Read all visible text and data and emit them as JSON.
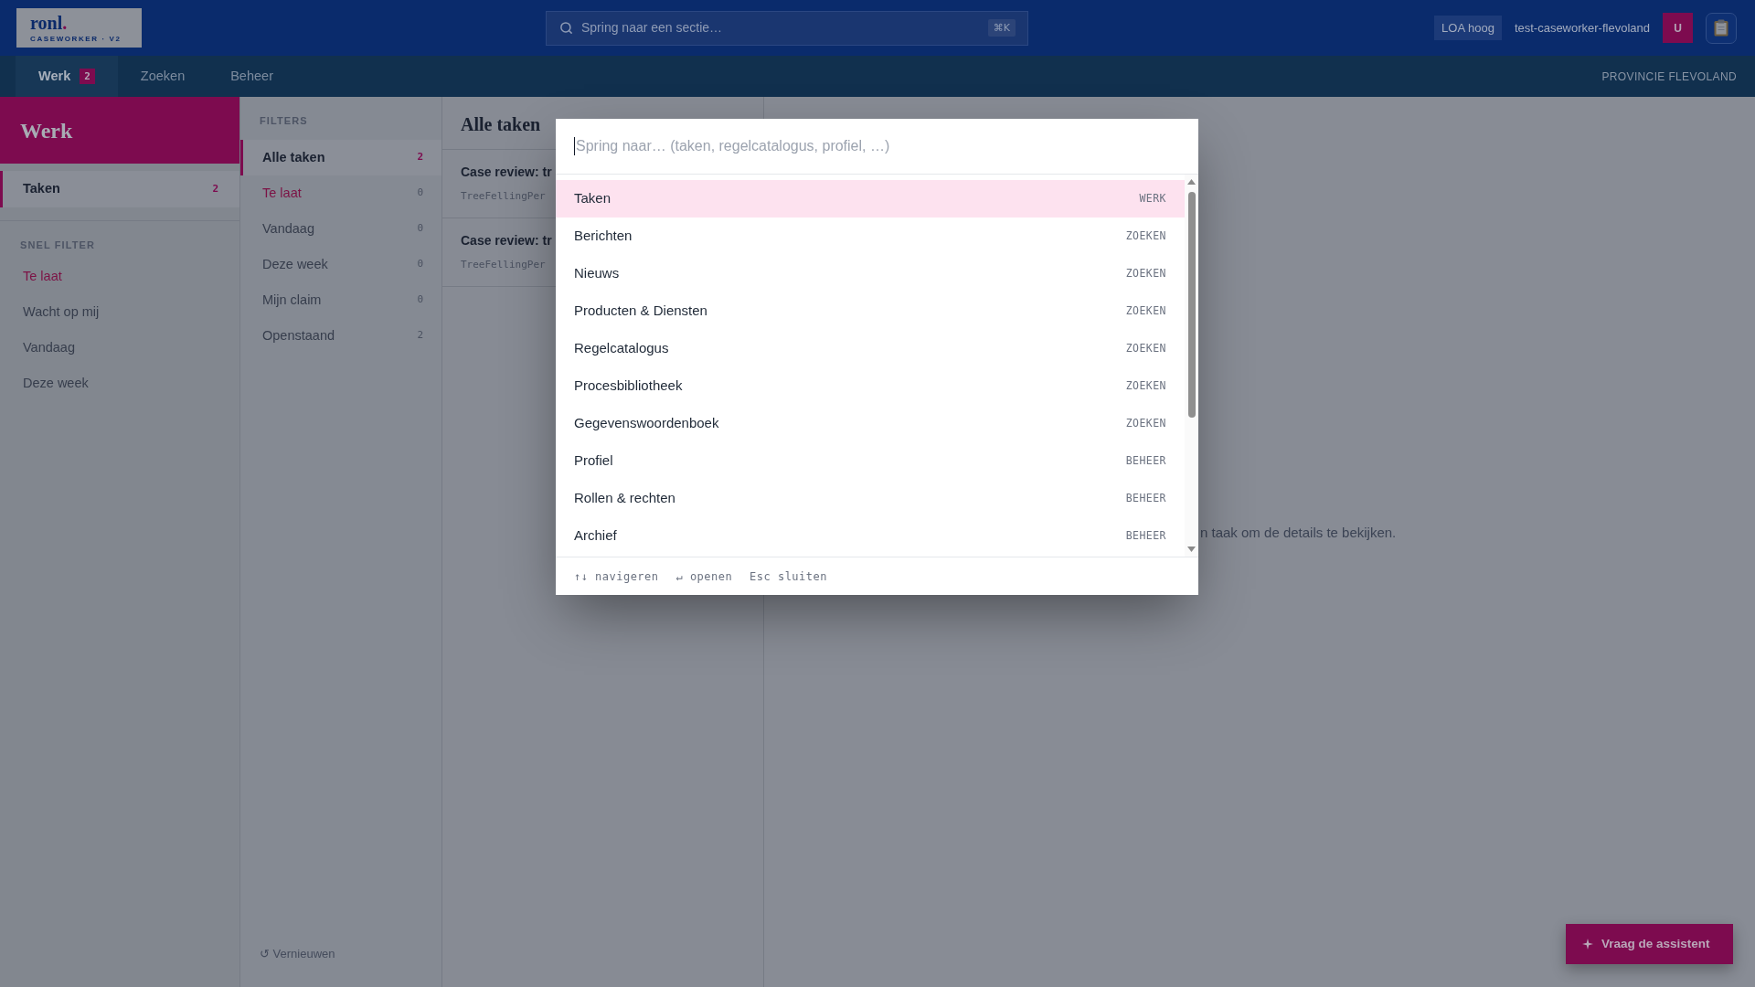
{
  "header": {
    "logo": {
      "wordmark": "ronl",
      "dot": ".",
      "subtitle": "CASEWORKER · V2"
    },
    "search": {
      "placeholder": "Spring naar een sectie…",
      "shortcut": "⌘K"
    },
    "loa_badge": "LOA hoog",
    "username": "test-caseworker-flevoland",
    "avatar": "U"
  },
  "nav": {
    "tabs": [
      {
        "label": "Werk",
        "count": "2",
        "selected": true
      },
      {
        "label": "Zoeken",
        "selected": false
      },
      {
        "label": "Beheer",
        "selected": false
      }
    ],
    "organization": "PROVINCIE FLEVOLAND"
  },
  "sidebar": {
    "title": "Werk",
    "items": [
      {
        "label": "Taken",
        "count": "2",
        "selected": true
      }
    ],
    "quick_filter": {
      "heading": "SNEL FILTER",
      "items": [
        {
          "label": "Te laat",
          "kind": "alert"
        },
        {
          "label": "Wacht op mij",
          "kind": "normal"
        },
        {
          "label": "Vandaag",
          "kind": "normal"
        },
        {
          "label": "Deze week",
          "kind": "normal"
        }
      ]
    }
  },
  "filters": {
    "heading": "FILTERS",
    "items": [
      {
        "label": "Alle taken",
        "count": "2",
        "selected": true,
        "kind": "normal"
      },
      {
        "label": "Te laat",
        "count": "0",
        "selected": false,
        "kind": "alert"
      },
      {
        "label": "Vandaag",
        "count": "0",
        "selected": false,
        "kind": "normal"
      },
      {
        "label": "Deze week",
        "count": "0",
        "selected": false,
        "kind": "normal"
      },
      {
        "label": "Mijn claim",
        "count": "0",
        "selected": false,
        "kind": "normal"
      },
      {
        "label": "Openstaand",
        "count": "2",
        "selected": false,
        "kind": "normal"
      }
    ],
    "refresh": "↺ Vernieuwen"
  },
  "task_list": {
    "title": "Alle taken",
    "tasks": [
      {
        "title": "Case review: tr",
        "process": "TreeFellingPer"
      },
      {
        "title": "Case review: tr",
        "process": "TreeFellingPer"
      }
    ]
  },
  "detail": {
    "message": "n taak om de details te bekijken."
  },
  "command_palette": {
    "placeholder": "Spring naar… (taken, regelcatalogus, profiel, …)",
    "results": [
      {
        "label": "Taken",
        "section": "WERK",
        "selected": true
      },
      {
        "label": "Berichten",
        "section": "ZOEKEN",
        "selected": false
      },
      {
        "label": "Nieuws",
        "section": "ZOEKEN",
        "selected": false
      },
      {
        "label": "Producten & Diensten",
        "section": "ZOEKEN",
        "selected": false
      },
      {
        "label": "Regelcatalogus",
        "section": "ZOEKEN",
        "selected": false
      },
      {
        "label": "Procesbibliotheek",
        "section": "ZOEKEN",
        "selected": false
      },
      {
        "label": "Gegevenswoordenboek",
        "section": "ZOEKEN",
        "selected": false
      },
      {
        "label": "Profiel",
        "section": "BEHEER",
        "selected": false
      },
      {
        "label": "Rollen & rechten",
        "section": "BEHEER",
        "selected": false
      },
      {
        "label": "Archief",
        "section": "BEHEER",
        "selected": false
      }
    ],
    "hints": [
      "↑↓ navigeren",
      "↵ openen",
      "Esc sluiten"
    ]
  },
  "assistant_button": {
    "label": "Vraag de assistent"
  }
}
